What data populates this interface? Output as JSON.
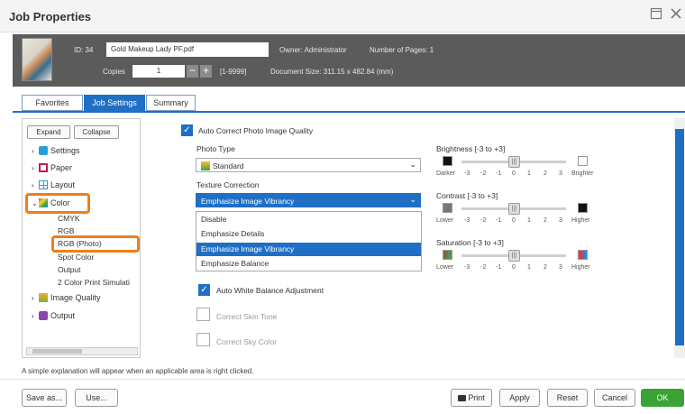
{
  "window": {
    "title": "Job Properties"
  },
  "info": {
    "id_label": "ID:",
    "id_value": "34",
    "doc_name": "Gold Makeup Lady PF.pdf",
    "owner_label": "Owner:",
    "owner_value": "Administrator",
    "pages_label": "Number of Pages:",
    "pages_value": "1",
    "copies_label": "Copies",
    "copies_value": "1",
    "copies_range": "[1-9999]",
    "docsize_label": "Document Size:",
    "docsize_value": "311.15 x 482.84 (mm)"
  },
  "tabs": [
    "Favorites",
    "Job Settings",
    "Summary"
  ],
  "tree": {
    "expand": "Expand",
    "collapse": "Collapse",
    "items": [
      "Settings",
      "Paper",
      "Layout",
      "Color",
      "Image Quality",
      "Output"
    ],
    "color_sub": [
      "CMYK",
      "RGB",
      "RGB (Photo)",
      "Spot Color",
      "Output",
      "2 Color Print Simulati"
    ]
  },
  "main": {
    "auto_correct": "Auto Correct Photo Image Quality",
    "photo_type_label": "Photo Type",
    "photo_type_value": "Standard",
    "texture_label": "Texture Correction",
    "texture_value": "Emphasize Image Vibrancy",
    "texture_options": [
      "Disable",
      "Emphasize Details",
      "Emphasize Image Vibrancy",
      "Emphasize Balance"
    ],
    "auto_wb": "Auto White Balance Adjustment",
    "skin_tone": "Correct Skin Tone",
    "sky_color": "Correct Sky Color"
  },
  "sliders": [
    {
      "label": "Brightness [-3 to +3]",
      "low": "Darker",
      "high": "Brighter",
      "value": 0
    },
    {
      "label": "Contrast [-3 to +3]",
      "low": "Lower",
      "high": "Higher",
      "value": 0
    },
    {
      "label": "Saturation [-3 to +3]",
      "low": "Lower",
      "high": "Higher",
      "value": 0
    }
  ],
  "ticks": [
    "-3",
    "-2",
    "-1",
    "0",
    "1",
    "2",
    "3"
  ],
  "status_text": "A simple explanation will appear when an applicable area is right clicked.",
  "buttons": {
    "save_as": "Save as...",
    "use": "Use...",
    "print": "Print",
    "apply": "Apply",
    "reset": "Reset",
    "cancel": "Cancel",
    "ok": "OK"
  },
  "colors": {
    "accent": "#1f6fc5",
    "ok_green": "#3aa335",
    "highlight": "#ef7d1a"
  }
}
